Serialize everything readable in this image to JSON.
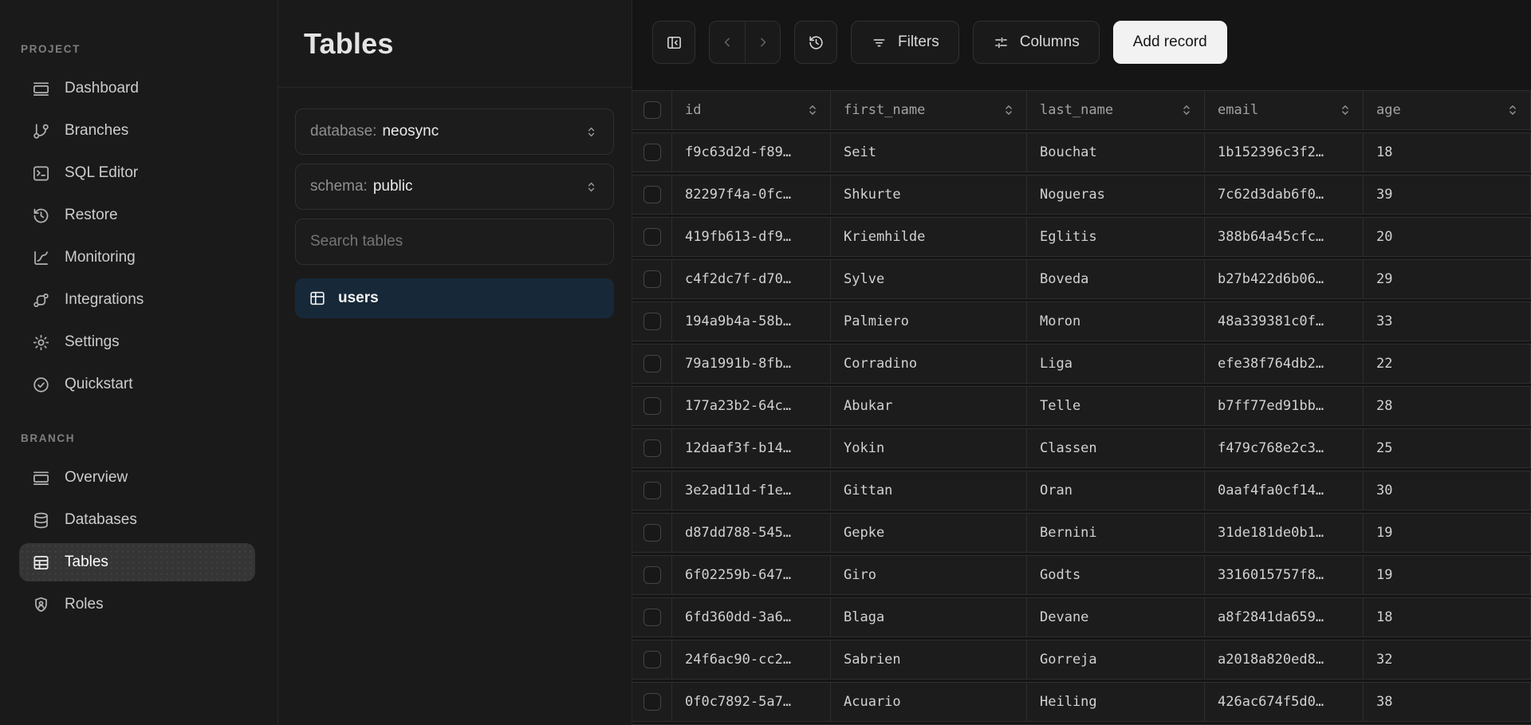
{
  "sidebar": {
    "sections": [
      {
        "label": "PROJECT",
        "items": [
          {
            "label": "Dashboard",
            "icon": "window",
            "active": false
          },
          {
            "label": "Branches",
            "icon": "git-branch",
            "active": false
          },
          {
            "label": "SQL Editor",
            "icon": "terminal",
            "active": false
          },
          {
            "label": "Restore",
            "icon": "history",
            "active": false
          },
          {
            "label": "Monitoring",
            "icon": "chart-spline",
            "active": false
          },
          {
            "label": "Integrations",
            "icon": "integrations",
            "active": false
          },
          {
            "label": "Settings",
            "icon": "gear",
            "active": false
          },
          {
            "label": "Quickstart",
            "icon": "circle-check",
            "active": false
          }
        ]
      },
      {
        "label": "BRANCH",
        "items": [
          {
            "label": "Overview",
            "icon": "window",
            "active": false
          },
          {
            "label": "Databases",
            "icon": "database",
            "active": false
          },
          {
            "label": "Tables",
            "icon": "table",
            "active": true
          },
          {
            "label": "Roles",
            "icon": "user-badge",
            "active": false
          }
        ]
      }
    ]
  },
  "panel": {
    "title": "Tables",
    "database_select": {
      "label": "database:",
      "value": "neosync"
    },
    "schema_select": {
      "label": "schema:",
      "value": "public"
    },
    "search_placeholder": "Search tables",
    "tables": [
      {
        "name": "users",
        "icon": "table-2",
        "selected": true
      }
    ]
  },
  "toolbar": {
    "collapse_panel_icon": "panel-left-close",
    "back_icon": "chevron-left",
    "forward_icon": "chevron-right",
    "history_icon": "history",
    "filters_label": "Filters",
    "columns_label": "Columns",
    "add_record_label": "Add record"
  },
  "table": {
    "columns": [
      "id",
      "first_name",
      "last_name",
      "email",
      "age"
    ],
    "rows": [
      {
        "id": "f9c63d2d-f89…",
        "first_name": "Seit",
        "last_name": "Bouchat",
        "email": "1b152396c3f2…",
        "age": "18"
      },
      {
        "id": "82297f4a-0fc…",
        "first_name": "Shkurte",
        "last_name": "Nogueras",
        "email": "7c62d3dab6f0…",
        "age": "39"
      },
      {
        "id": "419fb613-df9…",
        "first_name": "Kriemhilde",
        "last_name": "Eglitis",
        "email": "388b64a45cfc…",
        "age": "20"
      },
      {
        "id": "c4f2dc7f-d70…",
        "first_name": "Sylve",
        "last_name": "Boveda",
        "email": "b27b422d6b06…",
        "age": "29"
      },
      {
        "id": "194a9b4a-58b…",
        "first_name": "Palmiero",
        "last_name": "Moron",
        "email": "48a339381c0f…",
        "age": "33"
      },
      {
        "id": "79a1991b-8fb…",
        "first_name": "Corradino",
        "last_name": "Liga",
        "email": "efe38f764db2…",
        "age": "22"
      },
      {
        "id": "177a23b2-64c…",
        "first_name": "Abukar",
        "last_name": "Telle",
        "email": "b7ff77ed91bb…",
        "age": "28"
      },
      {
        "id": "12daaf3f-b14…",
        "first_name": "Yokin",
        "last_name": "Classen",
        "email": "f479c768e2c3…",
        "age": "25"
      },
      {
        "id": "3e2ad11d-f1e…",
        "first_name": "Gittan",
        "last_name": "Oran",
        "email": "0aaf4fa0cf14…",
        "age": "30"
      },
      {
        "id": "d87dd788-545…",
        "first_name": "Gepke",
        "last_name": "Bernini",
        "email": "31de181de0b1…",
        "age": "19"
      },
      {
        "id": "6f02259b-647…",
        "first_name": "Giro",
        "last_name": "Godts",
        "email": "3316015757f8…",
        "age": "19"
      },
      {
        "id": "6fd360dd-3a6…",
        "first_name": "Blaga",
        "last_name": "Devane",
        "email": "a8f2841da659…",
        "age": "18"
      },
      {
        "id": "24f6ac90-cc2…",
        "first_name": "Sabrien",
        "last_name": "Gorreja",
        "email": "a2018a820ed8…",
        "age": "32"
      },
      {
        "id": "0f0c7892-5a7…",
        "first_name": "Acuario",
        "last_name": "Heiling",
        "email": "426ac674f5d0…",
        "age": "38"
      }
    ]
  },
  "colors": {
    "selected_table_bg": "#172838",
    "active_nav_bg": "#353535",
    "add_record_bg": "#f2f2f2",
    "panel_bg": "#1a1a1a",
    "main_bg": "#151515",
    "row_bg": "#1c1c1c",
    "border": "#2e2e2e"
  }
}
